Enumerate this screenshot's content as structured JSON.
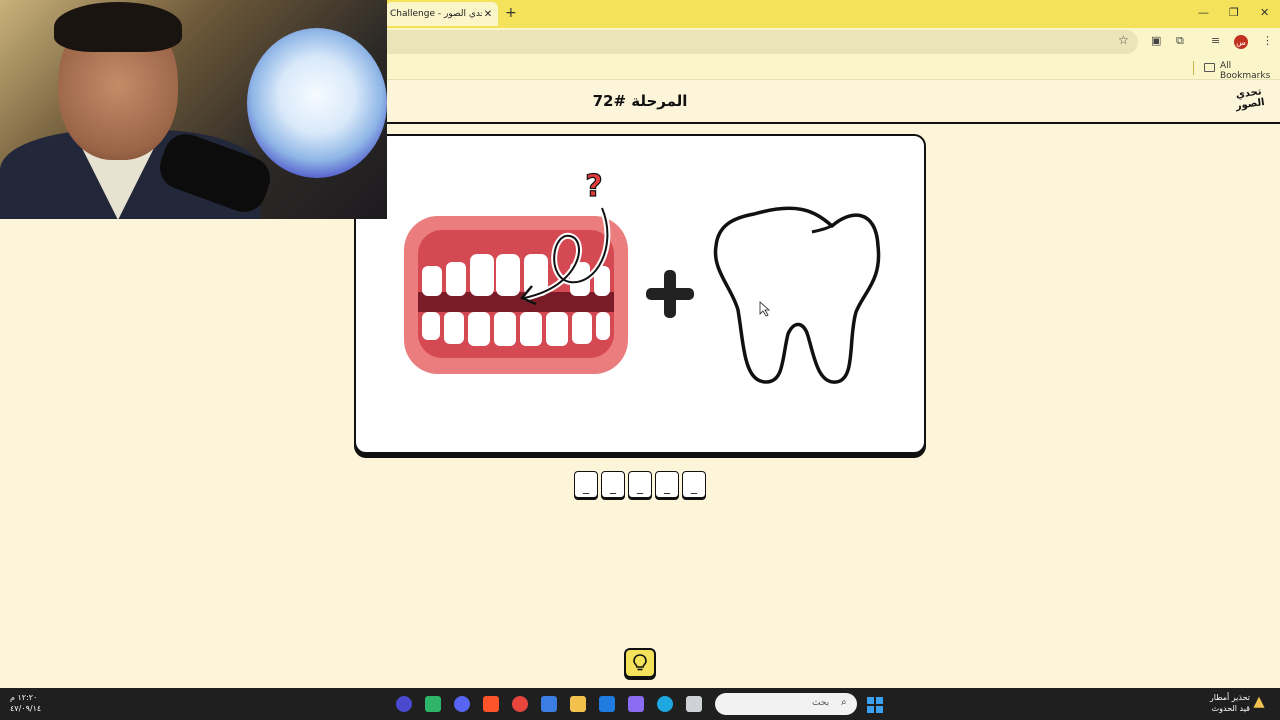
{
  "browser": {
    "tab_title": "Challenge - تحدي الصور",
    "tab_close": "✕",
    "new_tab": "+",
    "window_minimize": "—",
    "window_restore": "❐",
    "window_close": "✕",
    "bookmarks_label": "All Bookmarks",
    "profile_initial": "س"
  },
  "header": {
    "level_title": "المرحلة #72",
    "logo_text": "تحدي الصور"
  },
  "puzzle": {
    "left_image": "teeth-with-arrow-and-question-icon",
    "operator": "+",
    "right_image": "tooth-outline-icon",
    "question_mark": "?"
  },
  "answer": {
    "slots": [
      "_",
      "_",
      "_",
      "_",
      "_"
    ]
  },
  "hint": {
    "icon": "lightbulb-icon"
  },
  "taskbar": {
    "time": "١٢:٢٠ م",
    "date": "٤٧/٠٩/١٤",
    "search_placeholder": "بحث",
    "weather_title": "تحذير أمطار",
    "weather_subtitle": "قيد الحدوث",
    "colors": {
      "accent": "#f4e35a",
      "page_bg": "#fdf5d9"
    }
  }
}
